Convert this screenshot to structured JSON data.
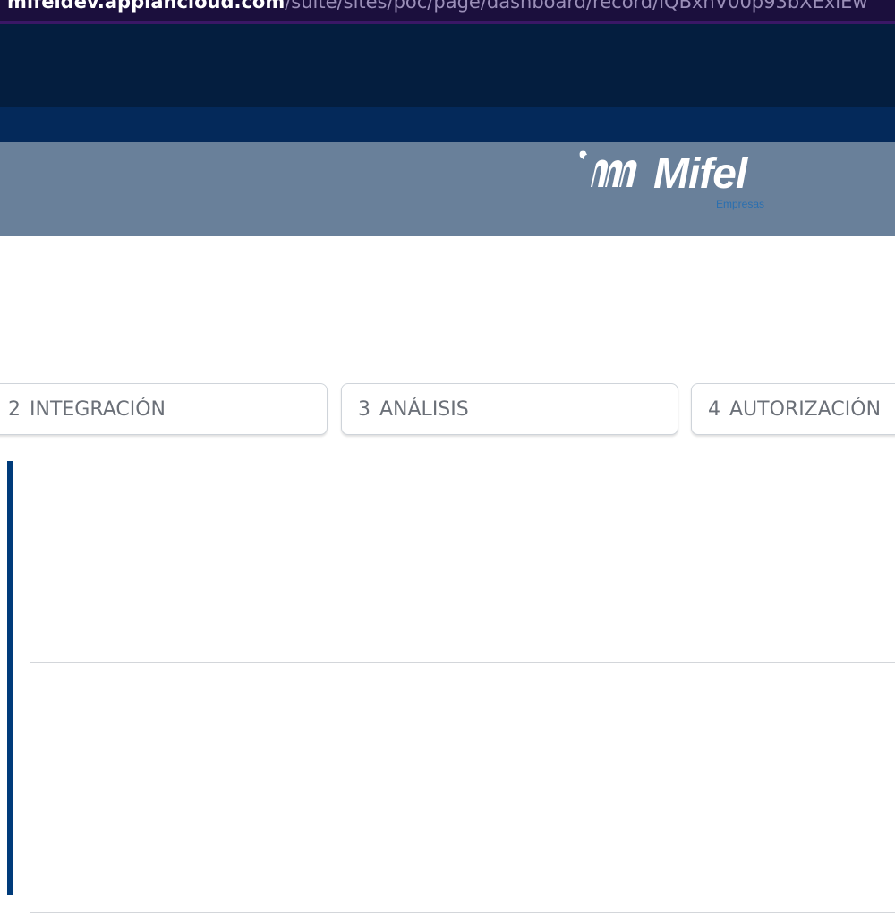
{
  "browser": {
    "url_domain": "mifeldev.appiancloud.com",
    "url_path": "/suite/sites/poc/page/dashboard/record/lQBxnV00p93bXExlEw"
  },
  "header": {
    "logo_text": "Mifel",
    "logo_subtitle": "Empresas",
    "background_color": "#69809a"
  },
  "steps": [
    {
      "number": "2",
      "label": "INTEGRACIÓN"
    },
    {
      "number": "3",
      "label": "ANÁLISIS"
    },
    {
      "number": "4",
      "label": "AUTORIZACIÓN"
    }
  ],
  "colors": {
    "url_bar": "#1b0f3d",
    "top_band": "#041e3f",
    "mid_band": "#04295a",
    "accent": "#003b7a"
  }
}
